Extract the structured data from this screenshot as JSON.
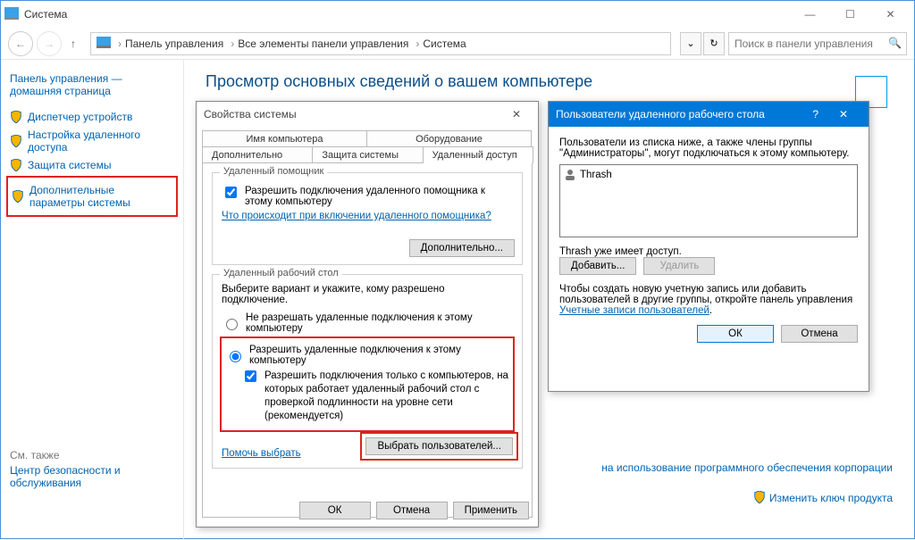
{
  "window": {
    "title": "Система",
    "min": "—",
    "max": "☐",
    "close": "✕"
  },
  "nav": {
    "breadcrumb": [
      "Панель управления",
      "Все элементы панели управления",
      "Система"
    ],
    "search_placeholder": "Поиск в панели управления"
  },
  "sidebar": {
    "home": "Панель управления — домашняя страница",
    "links": [
      "Диспетчер устройств",
      "Настройка удаленного доступа",
      "Защита системы",
      "Дополнительные параметры системы"
    ],
    "see_also_hdr": "См. также",
    "see_also": "Центр безопасности и обслуживания"
  },
  "content": {
    "heading": "Просмотр основных сведений о вашем компьютере",
    "license_link": "на использование программного обеспечения корпорации",
    "change_key": "Изменить ключ продукта"
  },
  "dlg_sys": {
    "title": "Свойства системы",
    "tabs": {
      "t1": "Имя компьютера",
      "t2": "Оборудование",
      "t3": "Дополнительно",
      "t4": "Защита системы",
      "t5": "Удаленный доступ"
    },
    "group1": {
      "legend": "Удаленный помощник",
      "chk": "Разрешить подключения удаленного помощника к этому компьютеру",
      "link": "Что происходит при включении удаленного помощника?",
      "btn": "Дополнительно..."
    },
    "group2": {
      "legend": "Удаленный рабочий стол",
      "desc": "Выберите вариант и укажите, кому разрешено подключение.",
      "r1": "Не разрешать удаленные подключения к этому компьютеру",
      "r2": "Разрешить удаленные подключения к этому компьютеру",
      "chk": "Разрешить подключения только с компьютеров, на которых работает удаленный рабочий стол с проверкой подлинности на уровне сети (рекомендуется)",
      "help": "Помочь выбрать",
      "select": "Выбрать пользователей..."
    },
    "ok": "ОК",
    "cancel": "Отмена",
    "apply": "Применить"
  },
  "dlg_ru": {
    "title": "Пользователи удаленного рабочего стола",
    "desc": "Пользователи из списка ниже, а также члены группы \"Администраторы\", могут подключаться к этому компьютеру.",
    "user": "Thrash",
    "already": "Thrash уже имеет доступ.",
    "add": "Добавить...",
    "del": "Удалить",
    "hint_pre": "Чтобы создать новую учетную запись или добавить пользователей в другие группы, откройте панель управления ",
    "hint_link": "Учетные записи пользователей",
    "ok": "ОК",
    "cancel": "Отмена"
  }
}
